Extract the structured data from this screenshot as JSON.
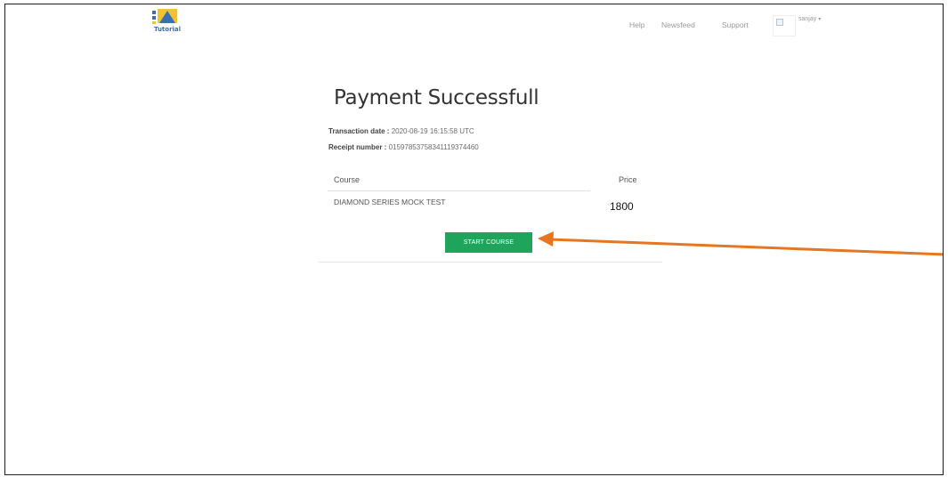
{
  "header": {
    "logo_text": "Tutorial",
    "nav": [
      "Help",
      "Newsfeed",
      "Support"
    ],
    "user_name": "sanjay",
    "user_caret": "▾"
  },
  "main": {
    "title": "Payment Successfull",
    "transaction_label": "Transaction date :",
    "transaction_value": " 2020-08-19 16:15:58 UTC",
    "receipt_label": "Receipt number :",
    "receipt_value": " 01597853758341119374460",
    "table": {
      "headers": [
        "Course",
        "Price"
      ],
      "rows": [
        {
          "course": "DIAMOND SERIES MOCK TEST",
          "price": "1800"
        }
      ]
    },
    "start_button": "START COURSE"
  },
  "colors": {
    "button": "#1ea55b",
    "annotation_arrow": "#e8751f",
    "logo_blue": "#3a6fb5",
    "logo_yellow": "#f2c230"
  },
  "icons": {
    "logo": "tutorial-logo-icon",
    "avatar": "broken-image-icon",
    "annotation": "arrow-left-annotation"
  }
}
